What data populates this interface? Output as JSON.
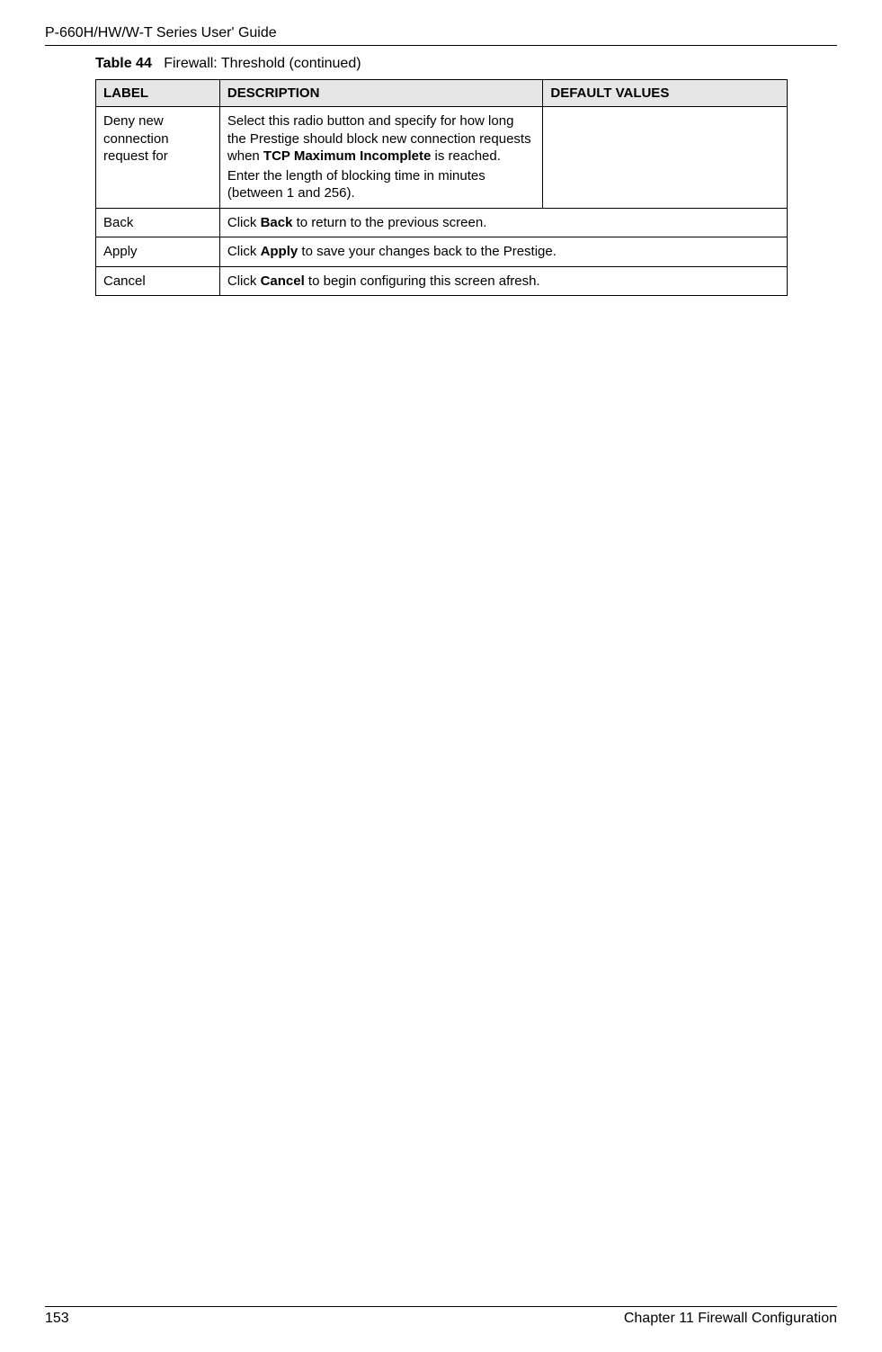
{
  "header": {
    "title": "P-660H/HW/W-T Series User' Guide"
  },
  "table": {
    "caption_label": "Table 44",
    "caption_text": "Firewall: Threshold (continued)",
    "columns": {
      "label": "LABEL",
      "description": "DESCRIPTION",
      "default_values": "DEFAULT VALUES"
    },
    "rows": [
      {
        "label": "Deny new connection request for",
        "desc_p1_prefix": "Select this radio button and specify for how long the Prestige should block new connection requests when ",
        "desc_p1_bold": "TCP Maximum Incomplete",
        "desc_p1_suffix": " is reached.",
        "desc_p2": "Enter the length of blocking time in minutes (between 1 and 256).",
        "default": ""
      },
      {
        "label": "Back",
        "desc_prefix": "Click ",
        "desc_bold": "Back",
        "desc_suffix": " to return to the previous screen."
      },
      {
        "label": "Apply",
        "desc_prefix": "Click ",
        "desc_bold": "Apply",
        "desc_suffix": " to save your changes back to the Prestige."
      },
      {
        "label": "Cancel",
        "desc_prefix": "Click ",
        "desc_bold": "Cancel",
        "desc_suffix": " to begin configuring this screen afresh."
      }
    ]
  },
  "footer": {
    "page_number": "153",
    "chapter": "Chapter 11 Firewall Configuration"
  }
}
